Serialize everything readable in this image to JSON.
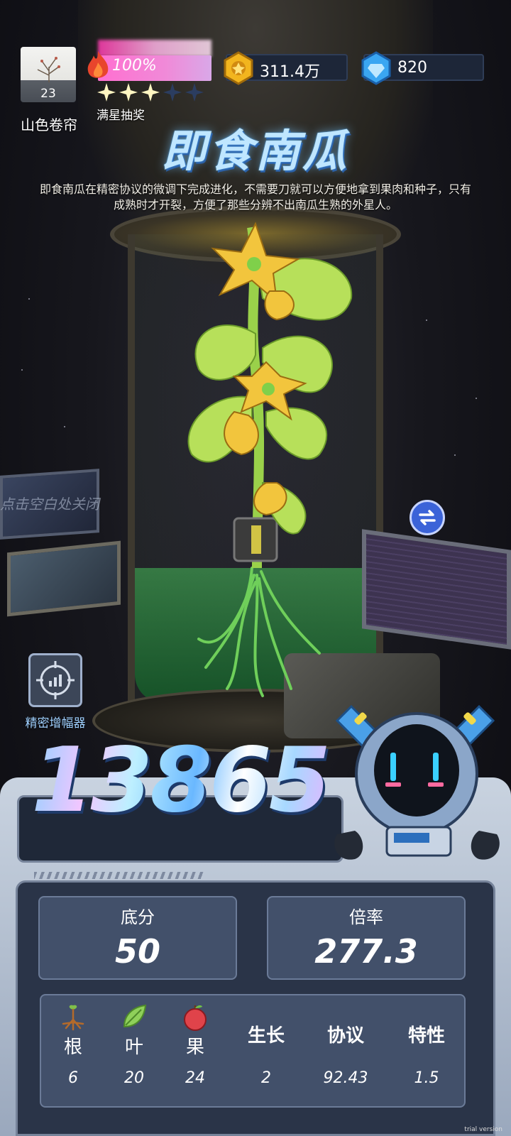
{
  "player": {
    "name": "山色卷帘",
    "level": "23"
  },
  "energy": {
    "percent_text": "100%",
    "fill": 1.0,
    "stars_filled": 3,
    "stars_total": 5,
    "lottery_label": "满星抽奖"
  },
  "currency": {
    "coins": "311.4万",
    "gems": "820"
  },
  "plant": {
    "title": "即食南瓜",
    "description": "即食南瓜在精密协议的微调下完成进化，不需要刀就可以方便地拿到果肉和种子，只有成熟时才开裂，方便了那些分辨不出南瓜生熟的外星人。"
  },
  "hints": {
    "close": "点击空白处关闭",
    "amplifier": "精密增幅器"
  },
  "score": {
    "total": "13865",
    "base_label": "底分",
    "base_value": "50",
    "multiplier_label": "倍率",
    "multiplier_value": "277.3"
  },
  "attributes": [
    {
      "label": "根",
      "value": "6",
      "icon": "root-icon"
    },
    {
      "label": "叶",
      "value": "20",
      "icon": "leaf-icon"
    },
    {
      "label": "果",
      "value": "24",
      "icon": "fruit-icon"
    },
    {
      "label": "生长",
      "value": "2",
      "icon": ""
    },
    {
      "label": "协议",
      "value": "92.43",
      "icon": ""
    },
    {
      "label": "特性",
      "value": "1.5",
      "icon": ""
    }
  ],
  "colors": {
    "accent_blue": "#3b63d8",
    "energy_pink": "#ff6fd0",
    "panel_bg": "#2a3448",
    "card_bg": "#42506a",
    "liquid_green": "#46be5a"
  },
  "watermark": "trial version"
}
